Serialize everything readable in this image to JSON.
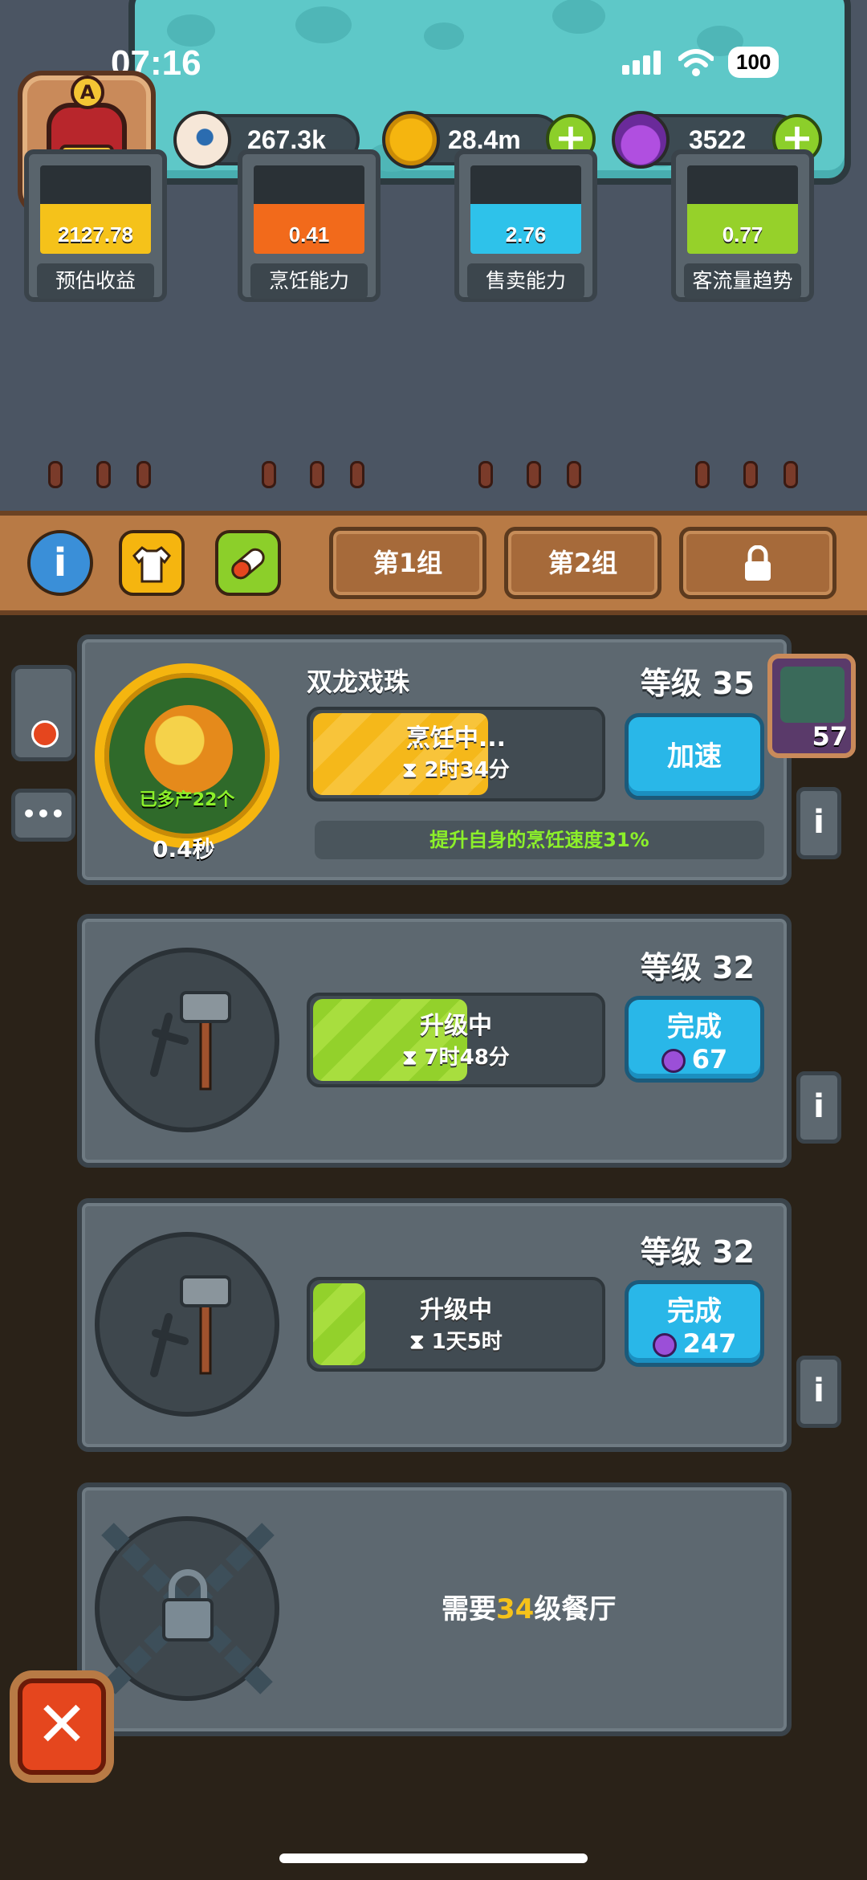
{
  "status_bar": {
    "time": "07:16",
    "battery": "100"
  },
  "resources": {
    "eyeball": {
      "value": "267.3k",
      "icon": "eyeball-icon"
    },
    "coins": {
      "value": "28.4m",
      "icon": "coin-icon"
    },
    "potion": {
      "value": "3522",
      "icon": "potion-icon"
    },
    "plus": "+"
  },
  "gauges": [
    {
      "value": "2127.78",
      "label": "预估收益",
      "color": "#f5c21a",
      "level": 0.56
    },
    {
      "value": "0.41",
      "label": "烹饪能力",
      "color": "#f26a1b",
      "level": 0.56
    },
    {
      "value": "2.76",
      "label": "售卖能力",
      "color": "#2ec2ea",
      "level": 0.56
    },
    {
      "value": "0.77",
      "label": "客流量趋势",
      "color": "#96d12a",
      "level": 0.56
    }
  ],
  "toolbar": {
    "info": "i",
    "tab1": "第1组",
    "tab2": "第2组"
  },
  "card1": {
    "name": "双龙戏珠",
    "level": "等级 35",
    "extra_produced": "已多产22个",
    "speed": "0.4秒",
    "status": "烹饪中...",
    "timer": "2时34分",
    "progress": 0.62,
    "button": "加速",
    "bonus": "提升自身的烹饪速度31%",
    "more": "•••",
    "side_badge": "57"
  },
  "card2": {
    "level": "等级 32",
    "status": "升级中",
    "timer": "7时48分",
    "progress": 0.55,
    "button": "完成",
    "cost": "67"
  },
  "card3": {
    "level": "等级 32",
    "status": "升级中",
    "timer": "1天5时",
    "progress": 0.2,
    "button": "完成",
    "cost": "247"
  },
  "card4": {
    "req_prefix": "需要",
    "req_level": "34",
    "req_suffix": "级餐厅"
  },
  "info_icon": "i",
  "hourglass": "⧗",
  "close": "✕"
}
